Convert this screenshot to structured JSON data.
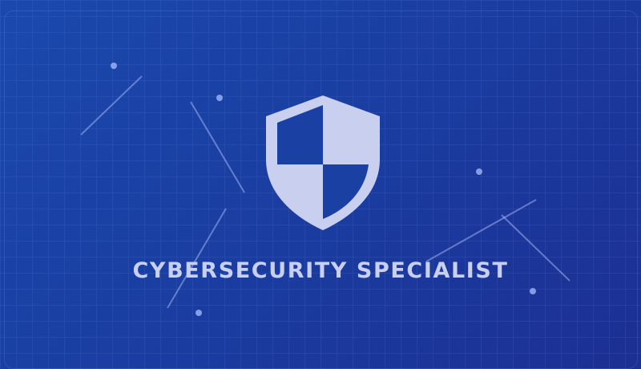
{
  "colors": {
    "background_top": "#1a49ad",
    "background_bottom": "#1c2f93",
    "accent_light": "#c9cfee",
    "shield_fill": "#c9cfee",
    "shield_cutout": "#1b40a3"
  },
  "icon": "shield-icon",
  "title": "CYBERSECURITY SPECIALIST"
}
